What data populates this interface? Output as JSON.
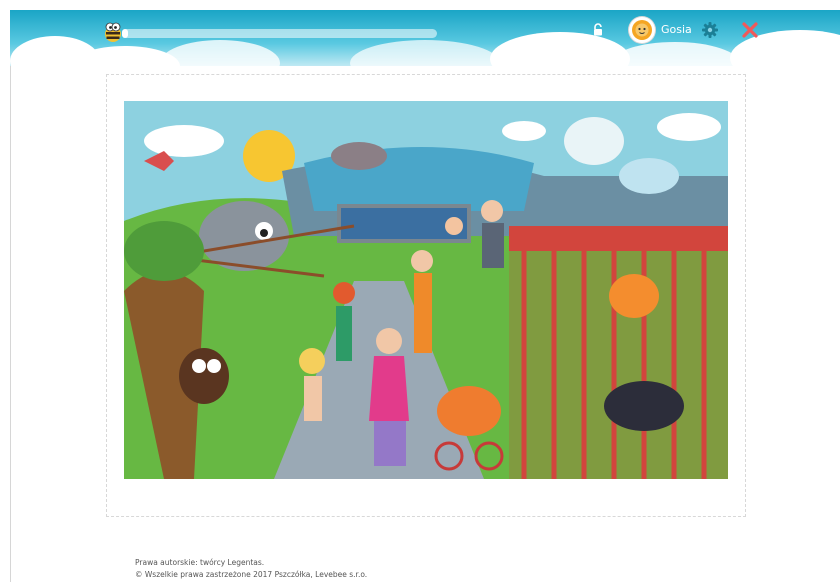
{
  "header": {
    "user_name": "Gosia",
    "progress": 0.02,
    "icons": [
      "bee-logo-icon",
      "lock-icon",
      "avatar-icon",
      "gear-icon",
      "close-icon"
    ]
  },
  "colors": {
    "header_top": "#1aa5c6",
    "header_bottom": "#bfe9f3",
    "gear": "#1b7f96",
    "close": "#f0595a"
  },
  "scene": {
    "description_icon": "zoo-illustration"
  },
  "footer": {
    "line1": "Prawa autorskie: twórcy Legentas.",
    "line2": "© Wszelkie prawa zastrzeżone 2017 Pszczółka, Levebee s.r.o."
  }
}
